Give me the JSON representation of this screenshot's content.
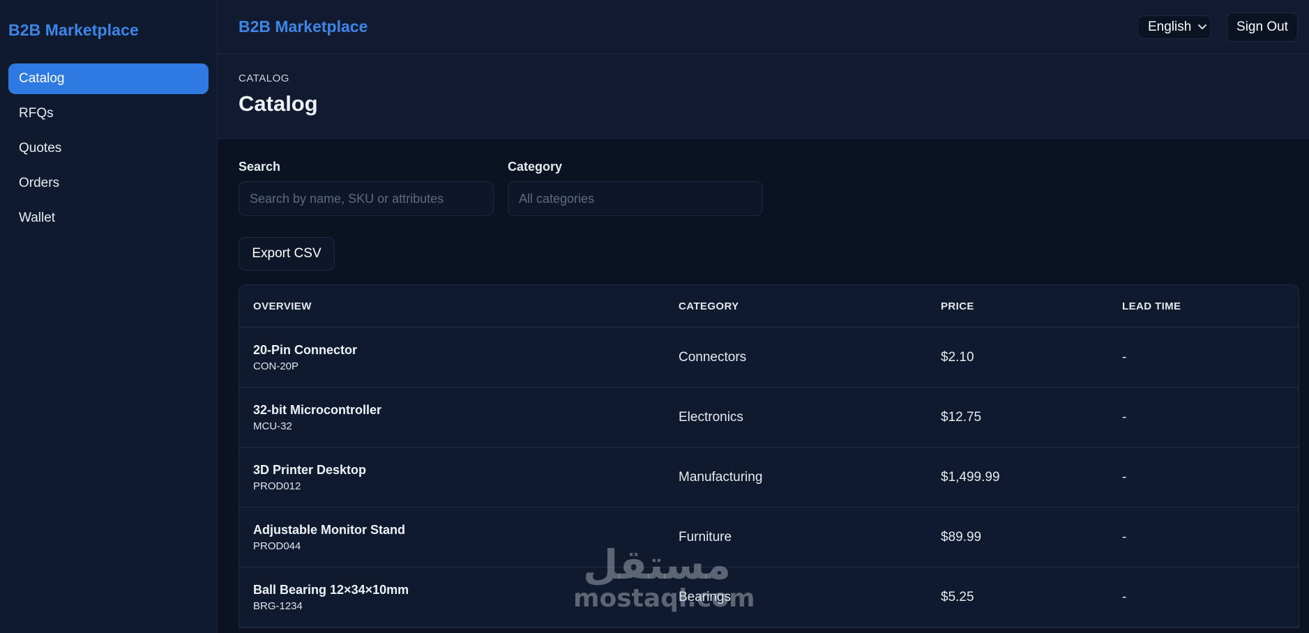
{
  "sidebar": {
    "brand": "B2B Marketplace",
    "items": [
      {
        "label": "Catalog"
      },
      {
        "label": "RFQs"
      },
      {
        "label": "Quotes"
      },
      {
        "label": "Orders"
      },
      {
        "label": "Wallet"
      }
    ],
    "active_index": 0
  },
  "topbar": {
    "title": "B2B Marketplace",
    "language": "English",
    "sign_out": "Sign Out"
  },
  "page": {
    "breadcrumb": "CATALOG",
    "title": "Catalog"
  },
  "filters": {
    "search_label": "Search",
    "search_placeholder": "Search by name, SKU or attributes",
    "category_label": "Category",
    "category_placeholder": "All categories"
  },
  "actions": {
    "export": "Export CSV"
  },
  "table": {
    "headers": [
      "OVERVIEW",
      "CATEGORY",
      "PRICE",
      "LEAD TIME"
    ],
    "rows": [
      {
        "name": "20-Pin Connector",
        "sku": "CON-20P",
        "category": "Connectors",
        "price": "$2.10",
        "lead_time": "-"
      },
      {
        "name": "32-bit Microcontroller",
        "sku": "MCU-32",
        "category": "Electronics",
        "price": "$12.75",
        "lead_time": "-"
      },
      {
        "name": "3D Printer Desktop",
        "sku": "PROD012",
        "category": "Manufacturing",
        "price": "$1,499.99",
        "lead_time": "-"
      },
      {
        "name": "Adjustable Monitor Stand",
        "sku": "PROD044",
        "category": "Furniture",
        "price": "$89.99",
        "lead_time": "-"
      },
      {
        "name": "Ball Bearing 12×34×10mm",
        "sku": "BRG-1234",
        "category": "Bearings",
        "price": "$5.25",
        "lead_time": "-"
      }
    ]
  },
  "watermark": {
    "arabic": "مستقل",
    "latin": "mostaql.com"
  },
  "colors": {
    "accent": "#2f7ae2",
    "brand": "#3d85e8",
    "background": "#0b1322",
    "panel": "#101a2e"
  }
}
